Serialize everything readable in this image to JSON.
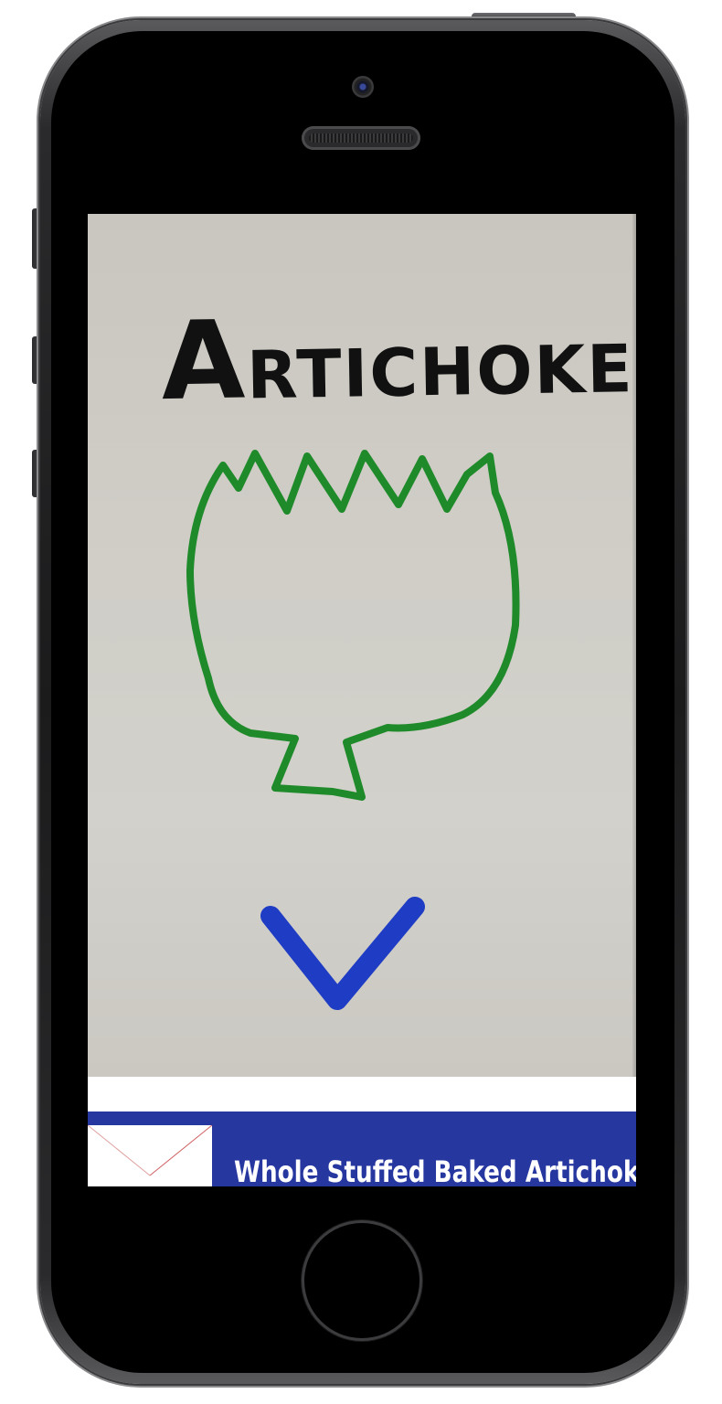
{
  "card": {
    "title_first_letter": "A",
    "title_rest": "RTICHOKE"
  },
  "result": {
    "title": "Whole Stuffed Baked Artichokes"
  },
  "icons": {
    "artichoke_sketch": "artichoke-drawing",
    "down_arrow": "chevron-down-icon",
    "placeholder_image": "broken-image-icon"
  },
  "colors": {
    "result_bar": "#2637a0",
    "sketch_green": "#1e8a2a",
    "arrow_blue": "#1f3cc4"
  }
}
